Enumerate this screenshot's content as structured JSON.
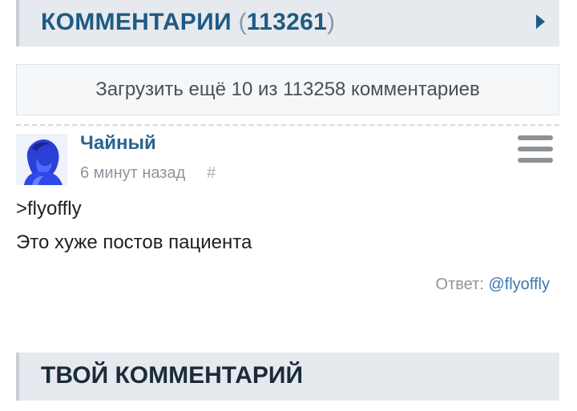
{
  "comments": {
    "title": "КОММЕНТАРИИ",
    "paren_open": "(",
    "count": "113261",
    "paren_close": ")",
    "load_more": "Загрузить ещё 10 из 113258 комментариев"
  },
  "comment": {
    "author": "Чайный",
    "time": "6 минут назад",
    "hash": "#",
    "quote": ">flyoffly",
    "text": "Это хуже постов пациента",
    "reply_label": "Ответ: ",
    "reply_user": "@flyoffly"
  },
  "your_comment": {
    "title": "ТВОЙ КОММЕНТАРИЙ"
  },
  "colors": {
    "accent": "#1f5a84",
    "link": "#3a77b0",
    "header_bg": "#e6e9ed"
  }
}
